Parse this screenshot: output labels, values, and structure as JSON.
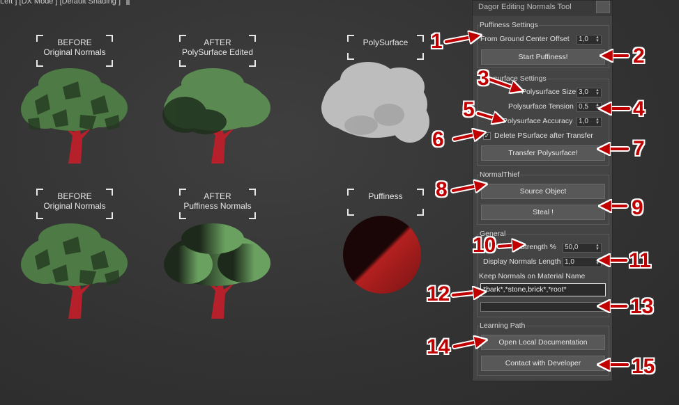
{
  "viewport": {
    "label": "Left ] [DX Mode ] [Default Shading ]",
    "frames": [
      {
        "line1": "BEFORE",
        "line2": "Original Normals"
      },
      {
        "line1": "AFTER",
        "line2": "PolySurface Edited"
      },
      {
        "line1": "PolySurface",
        "line2": ""
      },
      {
        "line1": "BEFORE",
        "line2": "Original Normals"
      },
      {
        "line1": "AFTER",
        "line2": "Puffiness Normals"
      },
      {
        "line1": "Puffiness",
        "line2": ""
      }
    ]
  },
  "panel": {
    "title": "Dagor Editing Normals Tool",
    "puffiness": {
      "group_label": "Puffiness Settings",
      "offset_label": "From Ground Center Offset",
      "offset_value": "1,0",
      "start_button": "Start Puffiness!"
    },
    "polysurface": {
      "group_label": "Polysurface Settings",
      "size_label": "Polysurface Size",
      "size_value": "3,0",
      "tension_label": "Polysurface Tension",
      "tension_value": "0,5",
      "accuracy_label": "Polysurface Accuracy",
      "accuracy_value": "1,0",
      "delete_label": "Delete PSurface after Transfer",
      "delete_checked": true,
      "transfer_button": "Transfer Polysurface!"
    },
    "normalthief": {
      "group_label": "NormalThief",
      "source_button": "Source Object",
      "steal_button": "Steal !"
    },
    "general": {
      "group_label": "General",
      "strength_label": "Strength %",
      "strength_value": "50,0",
      "display_label": "Display Normals Length",
      "display_value": "1,0",
      "keep_label": "Keep Normals on Material Name",
      "keep_value": "*bark*,*stone,brick*,*root*",
      "second_value": ""
    },
    "learning": {
      "group_label": "Learning Path",
      "docs_button": "Open Local Documentation",
      "contact_button": "Contact with Developer"
    }
  },
  "callouts": [
    "1",
    "2",
    "3",
    "4",
    "5",
    "6",
    "7",
    "8",
    "9",
    "10",
    "11",
    "12",
    "13",
    "14",
    "15"
  ],
  "colors": {
    "callout": "#c00000",
    "foliage": "#4e7a45",
    "trunk": "#b5202a",
    "sphere": "#8c1a1a"
  }
}
